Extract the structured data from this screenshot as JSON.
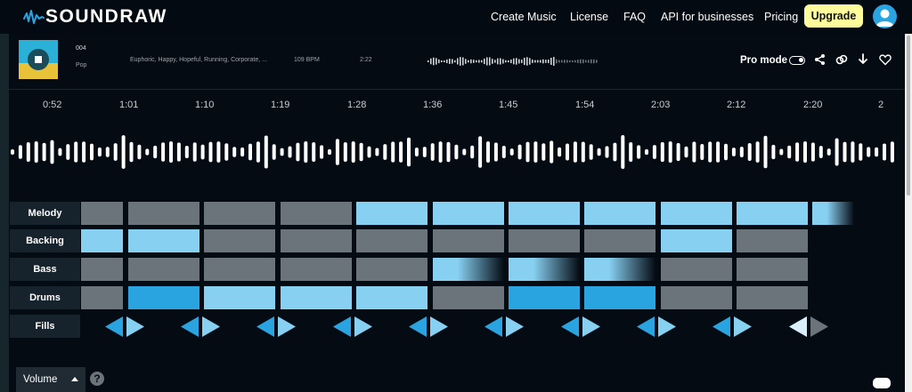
{
  "brand": {
    "name": "SOUNDRAW",
    "accent": "#2aa4e0",
    "upgrade_color": "#fdfb9b"
  },
  "nav": {
    "items": [
      "Create Music",
      "License",
      "FAQ",
      "API for businesses",
      "Pricing"
    ],
    "upgrade_label": "Upgrade"
  },
  "track": {
    "number": "004",
    "genre": "Pop",
    "moods": "Euphoric, Happy, Hopeful, Running, Corporate, ...",
    "bpm": "109 BPM",
    "duration": "2:22",
    "pro_mode_label": "Pro mode",
    "pro_mode_on": true
  },
  "timeline": {
    "times": [
      "0:52",
      "1:01",
      "1:10",
      "1:19",
      "1:28",
      "1:36",
      "1:45",
      "1:54",
      "2:03",
      "2:12",
      "2:20",
      "2"
    ]
  },
  "instruments": [
    {
      "label": "Melody",
      "blocks": [
        "gray",
        "gray",
        "gray",
        "gray",
        "light",
        "light",
        "light",
        "light",
        "light",
        "light",
        "light-fade"
      ]
    },
    {
      "label": "Backing",
      "blocks": [
        "light",
        "light",
        "gray",
        "gray",
        "gray",
        "gray",
        "gray",
        "gray",
        "light",
        "gray"
      ]
    },
    {
      "label": "Bass",
      "blocks": [
        "gray",
        "gray",
        "gray",
        "gray",
        "gray",
        "light-fade",
        "light-fade",
        "light-fade",
        "gray",
        "gray"
      ]
    },
    {
      "label": "Drums",
      "blocks": [
        "gray",
        "blue",
        "light",
        "light",
        "light",
        "gray",
        "blue",
        "blue",
        "gray",
        "gray"
      ]
    }
  ],
  "fills": {
    "label": "Fills",
    "pairs": [
      [
        "blue",
        "light"
      ],
      [
        "blue",
        "light"
      ],
      [
        "blue",
        "light"
      ],
      [
        "blue",
        "light"
      ],
      [
        "blue",
        "light"
      ],
      [
        "blue",
        "light"
      ],
      [
        "blue",
        "light"
      ],
      [
        "blue",
        "light"
      ],
      [
        "blue",
        "light"
      ],
      [
        "blue",
        "gray"
      ],
      [
        "white",
        null
      ]
    ]
  },
  "footer": {
    "volume_label": "Volume",
    "help_label": "?"
  },
  "colors": {
    "gray": "#6b747b",
    "light": "#87d0f1",
    "blue": "#2aa4e0",
    "white": "#d8eef8",
    "dark": "#050b13"
  }
}
